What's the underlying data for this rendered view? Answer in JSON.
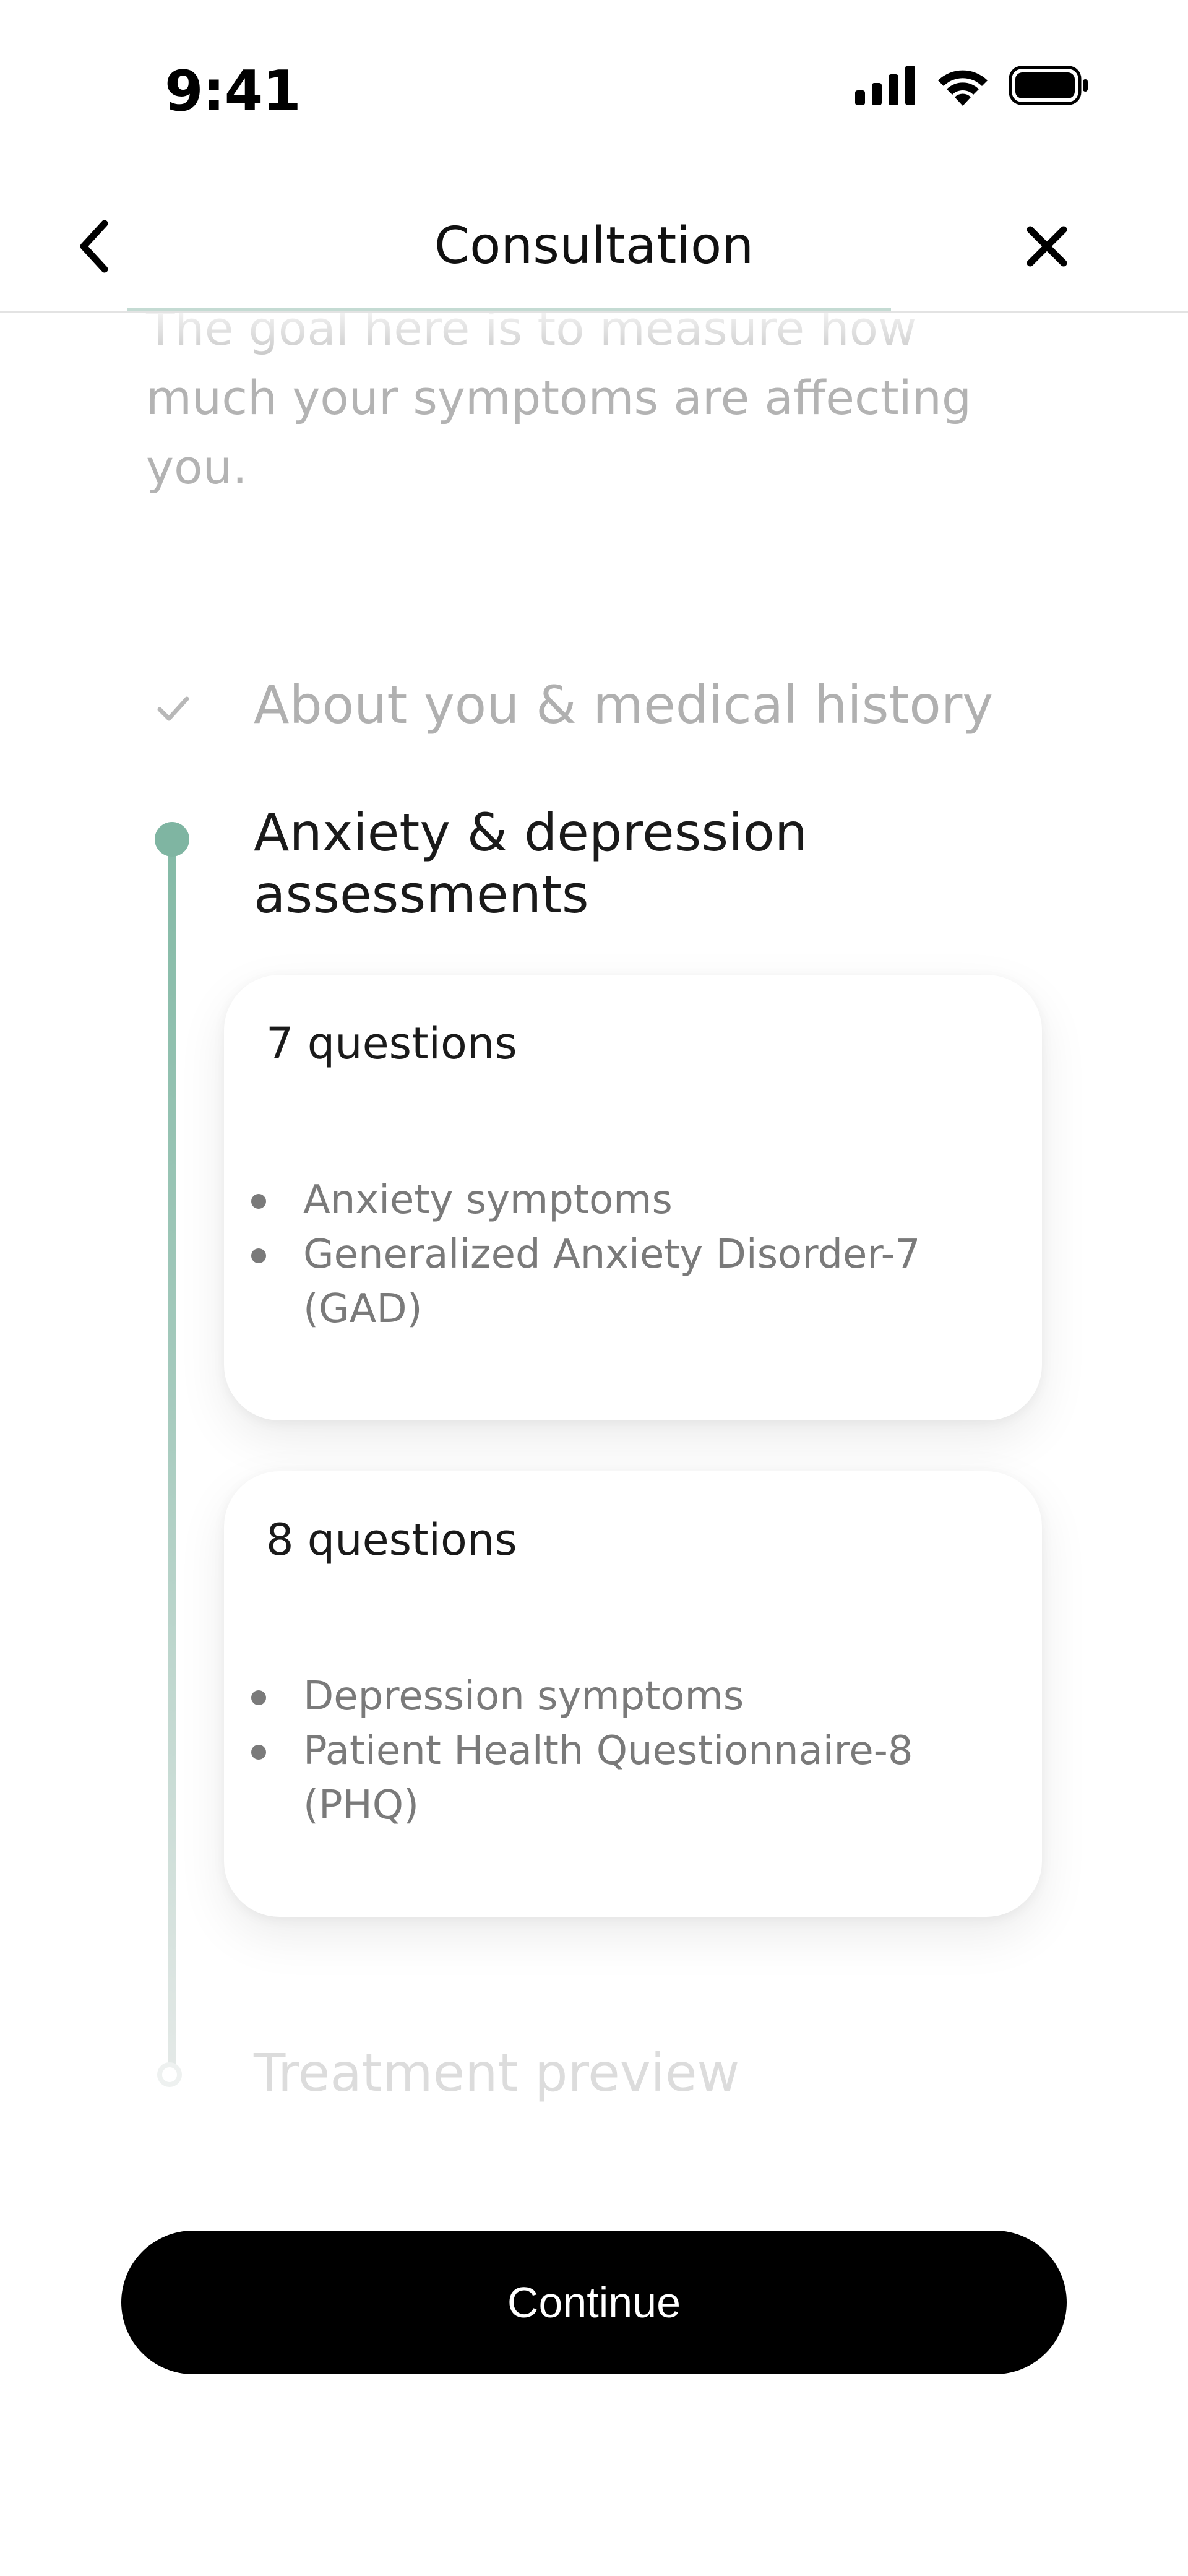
{
  "status_bar": {
    "time": "9:41",
    "icons": [
      "cellular-signal-icon",
      "wifi-icon",
      "battery-icon"
    ]
  },
  "header": {
    "title": "Consultation",
    "back_icon": "chevron-left-icon",
    "close_icon": "close-icon"
  },
  "intro_text": "The goal here is to measure how much your symptoms are affecting you.",
  "steps": [
    {
      "label": "About you & medical history",
      "state": "completed",
      "icon": "checkmark-icon"
    },
    {
      "label": "Anxiety & depression assessments",
      "state": "active"
    },
    {
      "label": "Treatment preview",
      "state": "upcoming"
    }
  ],
  "assessments": [
    {
      "title": "7 questions",
      "items": [
        "Anxiety symptoms",
        "Generalized Anxiety Disorder-7 (GAD)"
      ]
    },
    {
      "title": "8 questions",
      "items": [
        "Depression symptoms",
        "Patient Health Questionnaire-8 (PHQ)"
      ]
    }
  ],
  "continue_label": "Continue",
  "colors": {
    "accent": "#7fb5a2",
    "primary_button": "#000000",
    "muted_text": "#b3b3b3"
  }
}
